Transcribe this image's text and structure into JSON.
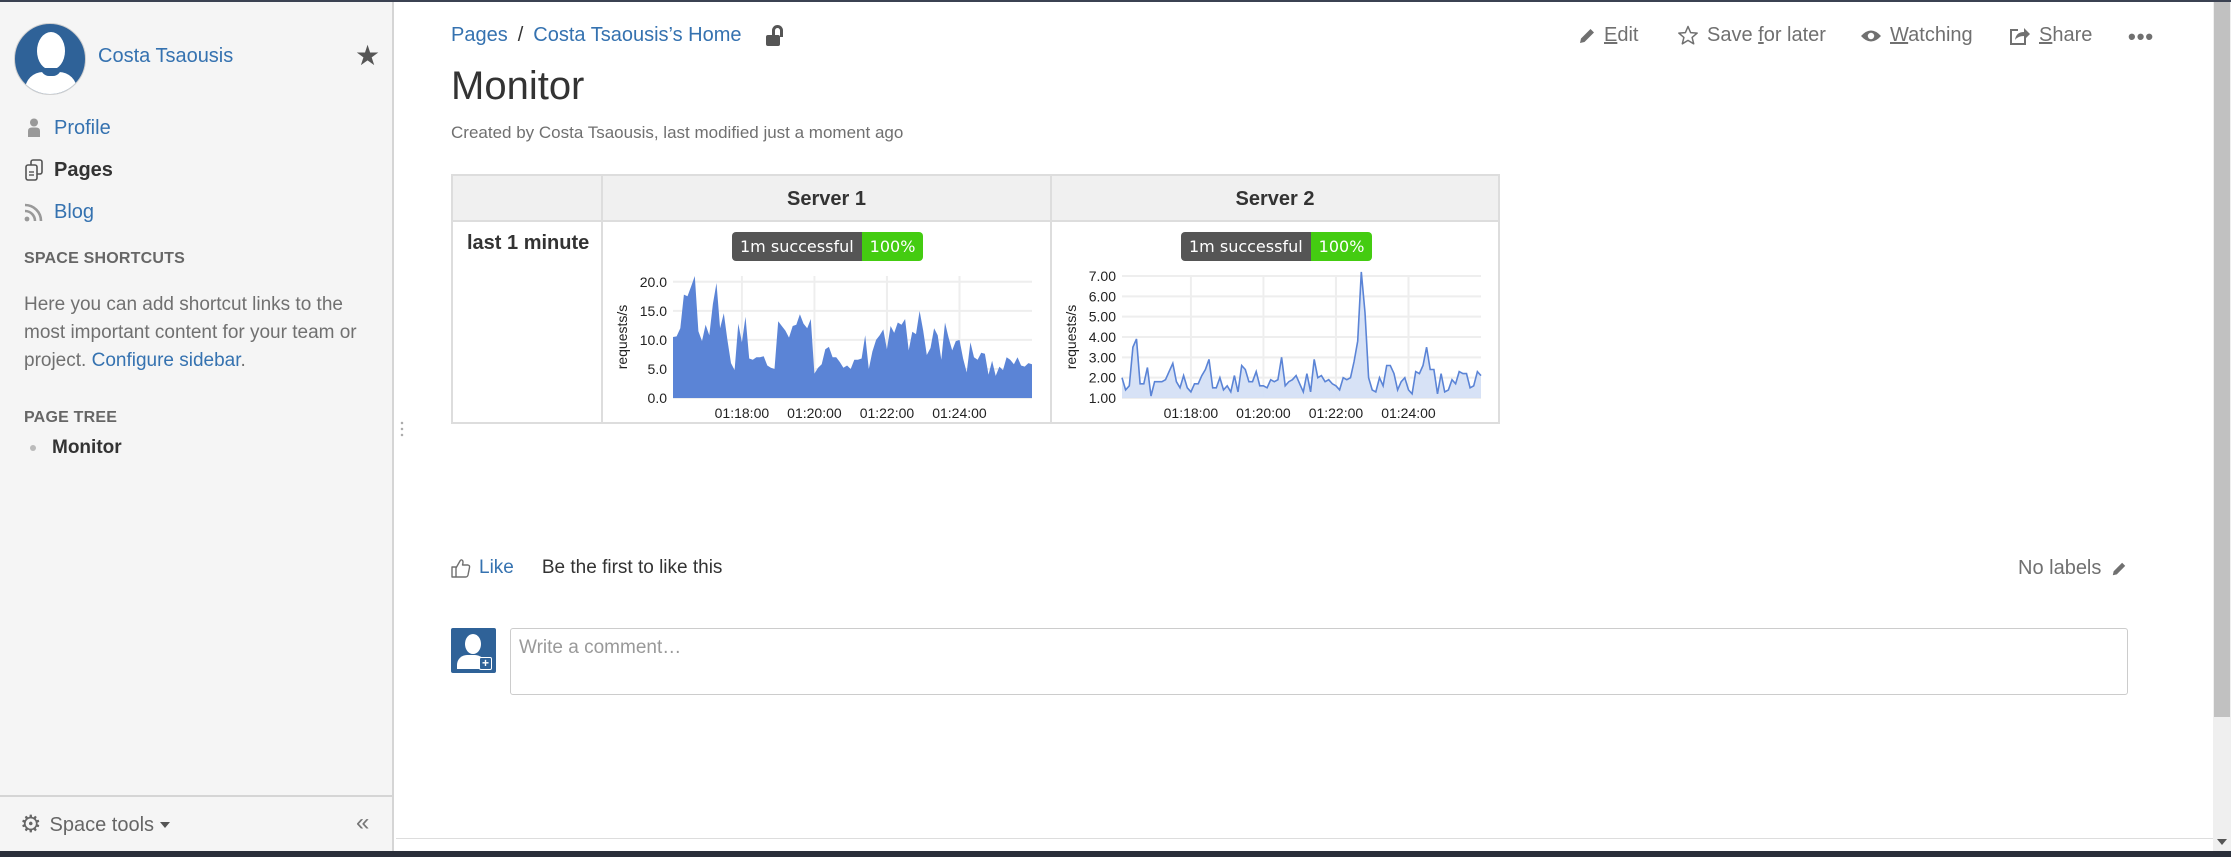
{
  "sidebar": {
    "space_name": "Costa Tsaousis",
    "nav": [
      {
        "label": "Profile",
        "icon": "person-icon",
        "active": false
      },
      {
        "label": "Pages",
        "icon": "pages-icon",
        "active": true
      },
      {
        "label": "Blog",
        "icon": "rss-icon",
        "active": false
      }
    ],
    "shortcuts_heading": "SPACE SHORTCUTS",
    "shortcuts_text": "Here you can add shortcut links to the most important content for your team or project.",
    "configure_link": "Configure sidebar",
    "configure_suffix": ".",
    "page_tree_heading": "PAGE TREE",
    "page_tree": [
      {
        "label": "Monitor"
      }
    ],
    "space_tools_label": "Space tools",
    "collapse_glyph": "«"
  },
  "breadcrumb": {
    "items": [
      "Pages",
      "Costa Tsaousis’s Home"
    ],
    "separator": "/"
  },
  "toolbar": {
    "edit": {
      "pre": "",
      "u": "E",
      "post": "dit"
    },
    "save": {
      "pre": "Save ",
      "u": "f",
      "post": "or later"
    },
    "watching": {
      "pre": "",
      "u": "W",
      "post": "atching"
    },
    "share": {
      "pre": "",
      "u": "S",
      "post": "hare"
    },
    "more": "•••"
  },
  "page": {
    "title": "Monitor",
    "meta": "Created by Costa Tsaousis, last modified just a moment ago"
  },
  "table": {
    "headers": [
      "",
      "Server 1",
      "Server 2"
    ],
    "row_label": "last 1 minute",
    "badge_label": "1m successful",
    "badge_value": "100%",
    "colors": {
      "badge_dark": "#555555",
      "badge_green": "#44cc11",
      "area_fill_1": "#5b84d6",
      "line_2": "#5b84d6",
      "area_fill_2": "#d3dff5"
    }
  },
  "chart_data": [
    {
      "type": "area",
      "title": "Server 1",
      "ylabel": "requests/s",
      "xlabel": "",
      "x_ticks": [
        "01:18:00",
        "01:20:00",
        "01:22:00",
        "01:24:00"
      ],
      "x_range_minutes": [
        76.1,
        86.0
      ],
      "x_tick_minutes": [
        78,
        80,
        82,
        84
      ],
      "y_ticks": [
        0,
        5,
        10,
        15,
        20
      ],
      "y_tick_labels": [
        "0.0",
        "5.0",
        "10.0",
        "15.0",
        "20.0"
      ],
      "ylim": [
        0,
        21
      ],
      "grid": true,
      "values": [
        10.5,
        10.6,
        12.0,
        17.8,
        17.5,
        19.2,
        21.0,
        11.5,
        9.8,
        12.6,
        10.8,
        16.2,
        19.8,
        12.0,
        14.6,
        10.0,
        6.0,
        4.8,
        12.8,
        9.6,
        14.0,
        6.8,
        6.6,
        7.0,
        7.0,
        7.2,
        5.6,
        5.2,
        5.0,
        13.2,
        12.4,
        11.6,
        10.4,
        12.4,
        12.6,
        14.4,
        12.8,
        12.0,
        13.6,
        4.2,
        5.2,
        5.8,
        8.4,
        8.8,
        7.0,
        7.0,
        6.2,
        5.2,
        5.6,
        5.0,
        6.6,
        6.6,
        6.8,
        10.8,
        5.0,
        8.0,
        10.0,
        10.8,
        11.8,
        8.4,
        12.4,
        11.2,
        13.0,
        12.6,
        13.6,
        8.2,
        11.4,
        11.0,
        15.0,
        11.6,
        7.4,
        8.6,
        12.0,
        10.8,
        6.6,
        13.0,
        10.4,
        8.2,
        9.8,
        10.0,
        6.8,
        4.4,
        9.6,
        7.0,
        6.6,
        7.8,
        7.6,
        4.0,
        6.4,
        3.8,
        5.4,
        4.8,
        7.0,
        6.6,
        5.8,
        7.0,
        5.6,
        5.4,
        6.0,
        5.8
      ]
    },
    {
      "type": "area",
      "title": "Server 2",
      "ylabel": "requests/s",
      "xlabel": "",
      "x_ticks": [
        "01:18:00",
        "01:20:00",
        "01:22:00",
        "01:24:00"
      ],
      "x_range_minutes": [
        76.1,
        86.0
      ],
      "x_tick_minutes": [
        78,
        80,
        82,
        84
      ],
      "y_ticks": [
        1,
        2,
        3,
        4,
        5,
        6,
        7
      ],
      "y_tick_labels": [
        "1.00",
        "2.00",
        "3.00",
        "4.00",
        "5.00",
        "6.00",
        "7.00"
      ],
      "ylim": [
        1,
        7
      ],
      "grid": true,
      "values": [
        2.0,
        1.4,
        1.6,
        3.5,
        3.9,
        1.7,
        1.7,
        2.5,
        1.1,
        1.8,
        1.8,
        1.8,
        1.9,
        2.3,
        2.7,
        1.8,
        1.5,
        2.1,
        1.5,
        1.3,
        1.7,
        1.7,
        2.1,
        2.4,
        2.9,
        1.5,
        1.5,
        2.0,
        1.4,
        1.6,
        1.3,
        2.1,
        1.3,
        2.6,
        2.4,
        1.8,
        1.8,
        2.3,
        1.6,
        1.6,
        1.5,
        1.9,
        1.8,
        1.9,
        3.0,
        1.6,
        1.8,
        1.9,
        2.1,
        1.7,
        1.3,
        2.2,
        1.3,
        2.9,
        2.0,
        2.1,
        1.8,
        1.9,
        1.7,
        1.6,
        1.4,
        2.0,
        1.9,
        2.0,
        2.8,
        3.8,
        7.2,
        5.2,
        2.0,
        1.4,
        1.3,
        2.0,
        1.6,
        2.6,
        2.6,
        2.2,
        1.4,
        1.8,
        2.0,
        1.4,
        1.2,
        2.3,
        2.2,
        2.6,
        3.5,
        2.4,
        2.4,
        1.2,
        2.2,
        1.3,
        1.4,
        1.9,
        1.7,
        2.3,
        2.2,
        2.2,
        1.5,
        1.6,
        2.3,
        2.1
      ]
    }
  ],
  "feedback": {
    "like_label": "Like",
    "like_message": "Be the first to like this",
    "labels_text": "No labels"
  },
  "comment": {
    "placeholder": "Write a comment…",
    "value": ""
  }
}
